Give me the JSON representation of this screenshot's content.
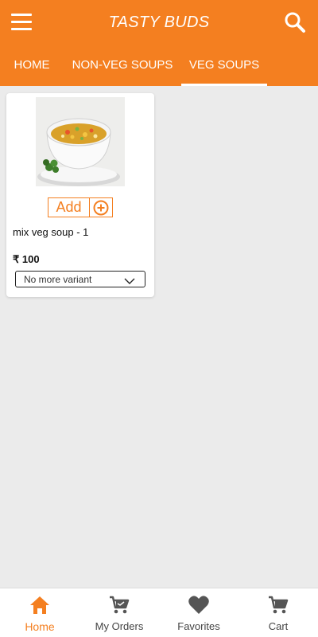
{
  "colors": {
    "brand": "#f47f20",
    "background": "#ebebeb",
    "icon_inactive": "#555555"
  },
  "header": {
    "title": "TASTY BUDS",
    "menu_icon": "menu-icon",
    "search_icon": "search-icon"
  },
  "tabs": [
    {
      "label": "HOME",
      "active": false
    },
    {
      "label": "NON-VEG SOUPS",
      "active": false
    },
    {
      "label": "VEG SOUPS",
      "active": true
    }
  ],
  "products": [
    {
      "name": "mix veg soup - 1",
      "add_label": "Add",
      "price": "₹ 100",
      "variant": "No more variant"
    }
  ],
  "bottom_nav": [
    {
      "label": "Home",
      "icon": "home-icon",
      "active": true
    },
    {
      "label": "My Orders",
      "icon": "cart-icon",
      "active": false
    },
    {
      "label": "Favorites",
      "icon": "heart-icon",
      "active": false
    },
    {
      "label": "Cart",
      "icon": "cart-icon",
      "active": false
    }
  ]
}
